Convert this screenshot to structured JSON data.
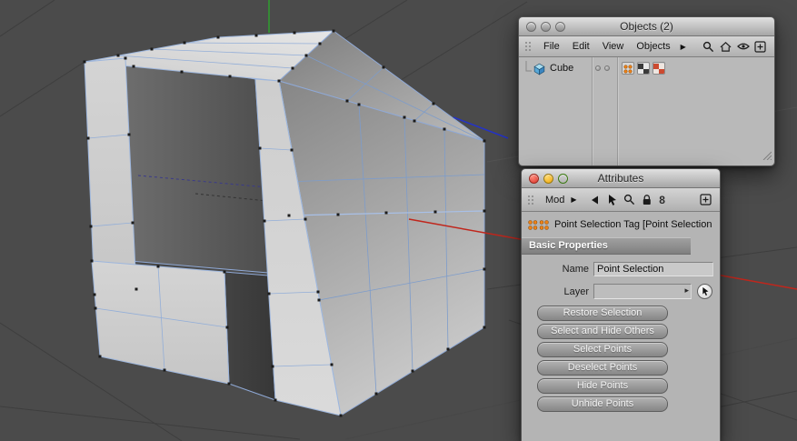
{
  "viewport": {
    "background_color": "#4b4b4b",
    "grid_color": "#3e3e3e",
    "x_axis_color": "#c0261c",
    "y_axis_color": "#2f9e2f",
    "z_axis_color": "#2433c8",
    "selection_edge_color": "#9db6dd",
    "selected_object": "Cube"
  },
  "objects_panel": {
    "title": "Objects (2)",
    "menus": [
      "File",
      "Edit",
      "View",
      "Objects"
    ],
    "menu_overflow_arrow": "▶",
    "rows": [
      {
        "name": "Cube",
        "tags": [
          "point-selection-tag",
          "uvw-tag",
          "texture-tag"
        ]
      }
    ]
  },
  "attributes_panel": {
    "title": "Attributes",
    "mode_label": "Mod",
    "mode_arrow": "▶",
    "history_glyph": "8",
    "tag_title": "Point Selection Tag [Point Selection",
    "section_title": "Basic Properties",
    "fields": [
      {
        "label": "Name",
        "value": "Point Selection"
      },
      {
        "label": "Layer",
        "value": ""
      }
    ],
    "buttons": [
      "Restore Selection",
      "Select and Hide Others",
      "Select Points",
      "Deselect Points",
      "Hide Points",
      "Unhide Points"
    ]
  }
}
